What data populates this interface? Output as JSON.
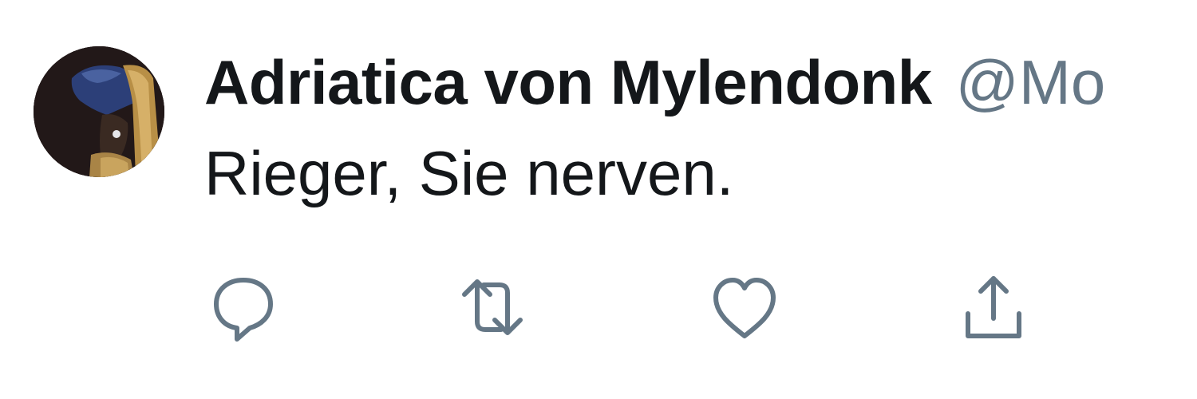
{
  "tweet": {
    "display_name": "Adriatica von Mylendonk",
    "handle": "@Mo",
    "text": "Rieger, Sie nerven."
  },
  "actions": [
    {
      "icon": "reply-icon",
      "label": "Reply"
    },
    {
      "icon": "retweet-icon",
      "label": "Retweet"
    },
    {
      "icon": "like-icon",
      "label": "Like"
    },
    {
      "icon": "share-icon",
      "label": "Share"
    }
  ],
  "colors": {
    "text_primary": "#14171a",
    "text_secondary": "#657786",
    "icon": "#657786",
    "background": "#ffffff"
  }
}
